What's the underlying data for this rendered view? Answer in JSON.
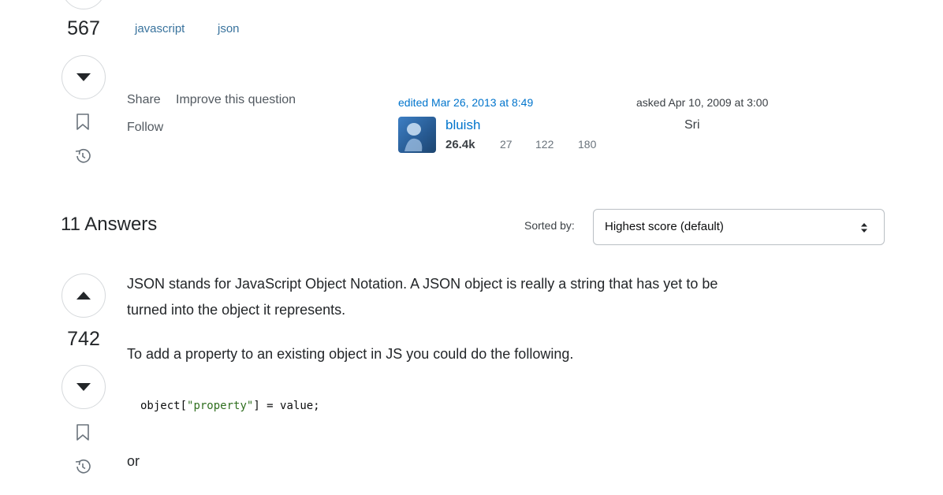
{
  "question": {
    "score": "567",
    "tags": [
      "javascript",
      "json"
    ],
    "actions": {
      "share": "Share",
      "improve": "Improve this question",
      "follow": "Follow"
    },
    "edited": {
      "label": "edited Mar 26, 2013 at 8:49",
      "user": "bluish",
      "reputation": "26.4k",
      "badges": {
        "gold": "27",
        "silver": "122",
        "bronze": "180"
      }
    },
    "asked": {
      "label": "asked Apr 10, 2009 at 3:00",
      "user": "Sri"
    }
  },
  "answers_header": {
    "title": "11 Answers",
    "sorted_by_label": "Sorted by:",
    "sort_value": "Highest score (default)"
  },
  "answer": {
    "score": "742",
    "paragraph1_line1": "JSON stands for JavaScript Object Notation. A JSON object is really a string that has yet to be",
    "paragraph1_line2": "turned into the object it represents.",
    "paragraph2": "To add a property to an existing object in JS you could do the following.",
    "code": {
      "prefix": "object[",
      "string": "\"property\"",
      "suffix": "] = value;"
    },
    "paragraph3": "or"
  },
  "icons": [
    "arrow-up-icon",
    "arrow-down-icon",
    "bookmark-icon",
    "history-icon",
    "select-caret-icon"
  ]
}
